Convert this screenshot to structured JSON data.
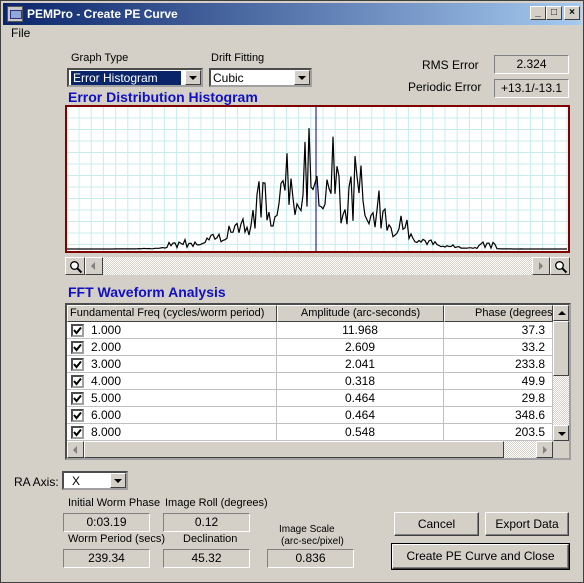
{
  "window": {
    "title": "PEMPro - Create PE Curve"
  },
  "menu": {
    "file": "File"
  },
  "graph_type": {
    "label": "Graph Type",
    "value": "Error Histogram"
  },
  "drift_fitting": {
    "label": "Drift Fitting",
    "value": "Cubic"
  },
  "rms_error": {
    "label": "RMS Error",
    "value": "2.324"
  },
  "periodic_error": {
    "label": "Periodic Error",
    "value": "+13.1/-13.1"
  },
  "histogram": {
    "title": "Error Distribution Histogram"
  },
  "fft": {
    "title": "FFT Waveform Analysis",
    "columns": [
      "Fundamental Freq (cycles/worm period)",
      "Amplitude (arc-seconds)",
      "Phase (degrees)"
    ],
    "rows": [
      {
        "checked": true,
        "freq": "1.000",
        "amplitude": "11.968",
        "phase": "37.3"
      },
      {
        "checked": true,
        "freq": "2.000",
        "amplitude": "2.609",
        "phase": "33.2"
      },
      {
        "checked": true,
        "freq": "3.000",
        "amplitude": "2.041",
        "phase": "233.8"
      },
      {
        "checked": true,
        "freq": "4.000",
        "amplitude": "0.318",
        "phase": "49.9"
      },
      {
        "checked": true,
        "freq": "5.000",
        "amplitude": "0.464",
        "phase": "29.8"
      },
      {
        "checked": true,
        "freq": "6.000",
        "amplitude": "0.464",
        "phase": "348.6"
      },
      {
        "checked": true,
        "freq": "8.000",
        "amplitude": "0.548",
        "phase": "203.5"
      }
    ]
  },
  "ra_axis": {
    "label": "RA Axis:",
    "value": "X"
  },
  "initial_worm_phase": {
    "label": "Initial Worm Phase",
    "value": "0:03.19"
  },
  "image_roll": {
    "label": "Image Roll (degrees)",
    "value": "0.12"
  },
  "worm_period": {
    "label": "Worm Period (secs)",
    "value": "239.34"
  },
  "declination": {
    "label": "Declination",
    "value": "45.32"
  },
  "image_scale": {
    "label_line1": "Image Scale",
    "label_line2": "(arc-sec/pixel)",
    "value": "0.836"
  },
  "buttons": {
    "cancel": "Cancel",
    "export": "Export Data",
    "create": "Create PE Curve and Close"
  },
  "colors": {
    "title_bar_start": "#0a246a",
    "section_title": "#1010c0",
    "histogram_border": "#800000",
    "grid_lines": "#c8ecec"
  }
}
